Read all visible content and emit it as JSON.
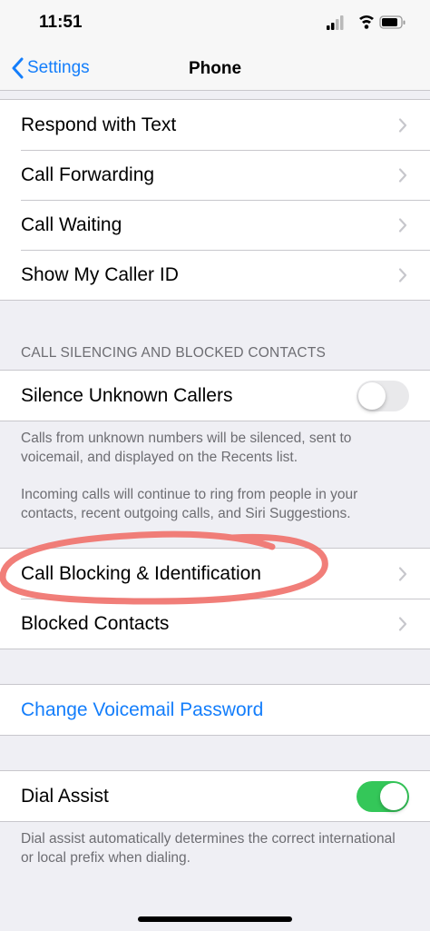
{
  "status_bar": {
    "time": "11:51"
  },
  "nav": {
    "back_label": "Settings",
    "title": "Phone"
  },
  "group1": {
    "items": [
      {
        "label": "Respond with Text"
      },
      {
        "label": "Call Forwarding"
      },
      {
        "label": "Call Waiting"
      },
      {
        "label": "Show My Caller ID"
      }
    ]
  },
  "silencing": {
    "header": "CALL SILENCING AND BLOCKED CONTACTS",
    "silence_label": "Silence Unknown Callers",
    "silence_on": false,
    "footer_1": "Calls from unknown numbers will be silenced, sent to voicemail, and displayed on the Recents list.",
    "footer_2": "Incoming calls will continue to ring from people in your contacts, recent outgoing calls, and Siri Suggestions."
  },
  "blocking": {
    "items": [
      {
        "label": "Call Blocking & Identification"
      },
      {
        "label": "Blocked Contacts"
      }
    ]
  },
  "voicemail": {
    "label": "Change Voicemail Password"
  },
  "dial_assist": {
    "label": "Dial Assist",
    "on": true,
    "footer": "Dial assist automatically determines the correct international or local prefix when dialing."
  },
  "colors": {
    "accent": "#147efb",
    "toggle_on": "#34c759",
    "annotation": "#f0706a"
  }
}
